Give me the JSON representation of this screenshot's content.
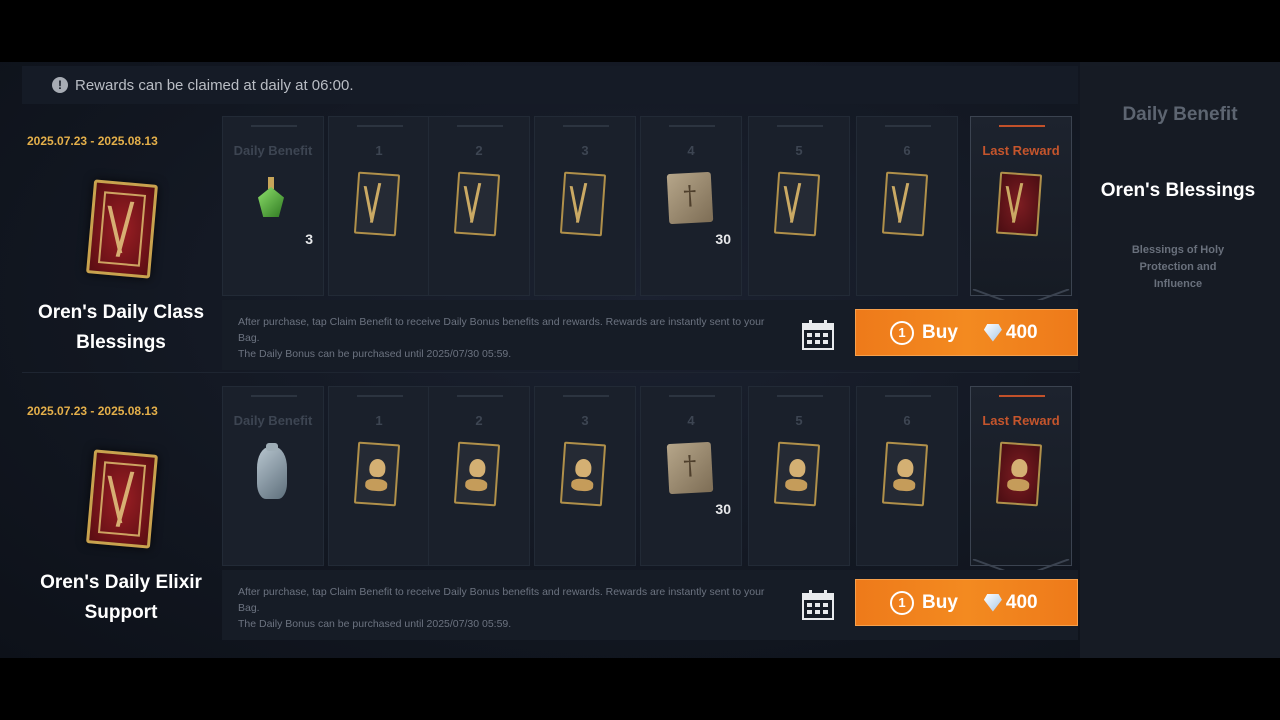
{
  "notice": "Rewards can be claimed at daily at 06:00.",
  "info_icon": "exclamation-circle-icon",
  "right_panel": {
    "header": "Daily Benefit",
    "title": "Oren's Blessings",
    "description": "Blessings of Holy Protection and Influence"
  },
  "products": [
    {
      "date_range": "2025.07.23 - 2025.08.13",
      "title_line1": "Oren's Daily Class",
      "title_line2": "Blessings",
      "slots": [
        {
          "label": "Daily Benefit",
          "qty": "3",
          "icon": "green-potion-icon"
        },
        {
          "label": "1",
          "qty": "",
          "icon": "class-card-icon"
        },
        {
          "label": "2",
          "qty": "",
          "icon": "class-card-icon"
        },
        {
          "label": "3",
          "qty": "",
          "icon": "class-card-icon"
        },
        {
          "label": "4",
          "qty": "30",
          "icon": "scroll-icon"
        },
        {
          "label": "5",
          "qty": "",
          "icon": "class-card-icon"
        },
        {
          "label": "6",
          "qty": "",
          "icon": "class-card-icon"
        },
        {
          "label": "Last Reward",
          "qty": "",
          "icon": "red-class-card-icon"
        }
      ],
      "desc_line1": "After purchase, tap Claim Benefit to receive Daily Bonus benefits and rewards. Rewards are instantly sent to your Bag.",
      "desc_line2": "The Daily Bonus can be purchased until 2025/07/30 05:59.",
      "buy_label": "Buy",
      "ticket_count": "1",
      "price": "400"
    },
    {
      "date_range": "2025.07.23 - 2025.08.13",
      "title_line1": "Oren's Daily Elixir",
      "title_line2": "Support",
      "slots": [
        {
          "label": "Daily Benefit",
          "qty": "",
          "icon": "elixir-vase-icon"
        },
        {
          "label": "1",
          "qty": "",
          "icon": "elixir-card-icon"
        },
        {
          "label": "2",
          "qty": "",
          "icon": "elixir-card-icon"
        },
        {
          "label": "3",
          "qty": "",
          "icon": "elixir-card-icon"
        },
        {
          "label": "4",
          "qty": "30",
          "icon": "shield-scroll-icon"
        },
        {
          "label": "5",
          "qty": "",
          "icon": "elixir-card-icon"
        },
        {
          "label": "6",
          "qty": "",
          "icon": "elixir-card-icon"
        },
        {
          "label": "Last Reward",
          "qty": "",
          "icon": "red-elixir-card-icon"
        }
      ],
      "desc_line1": "After purchase, tap Claim Benefit to receive Daily Bonus benefits and rewards. Rewards are instantly sent to your Bag.",
      "desc_line2": "The Daily Bonus can be purchased until 2025/07/30 05:59.",
      "buy_label": "Buy",
      "ticket_count": "1",
      "price": "400"
    }
  ]
}
